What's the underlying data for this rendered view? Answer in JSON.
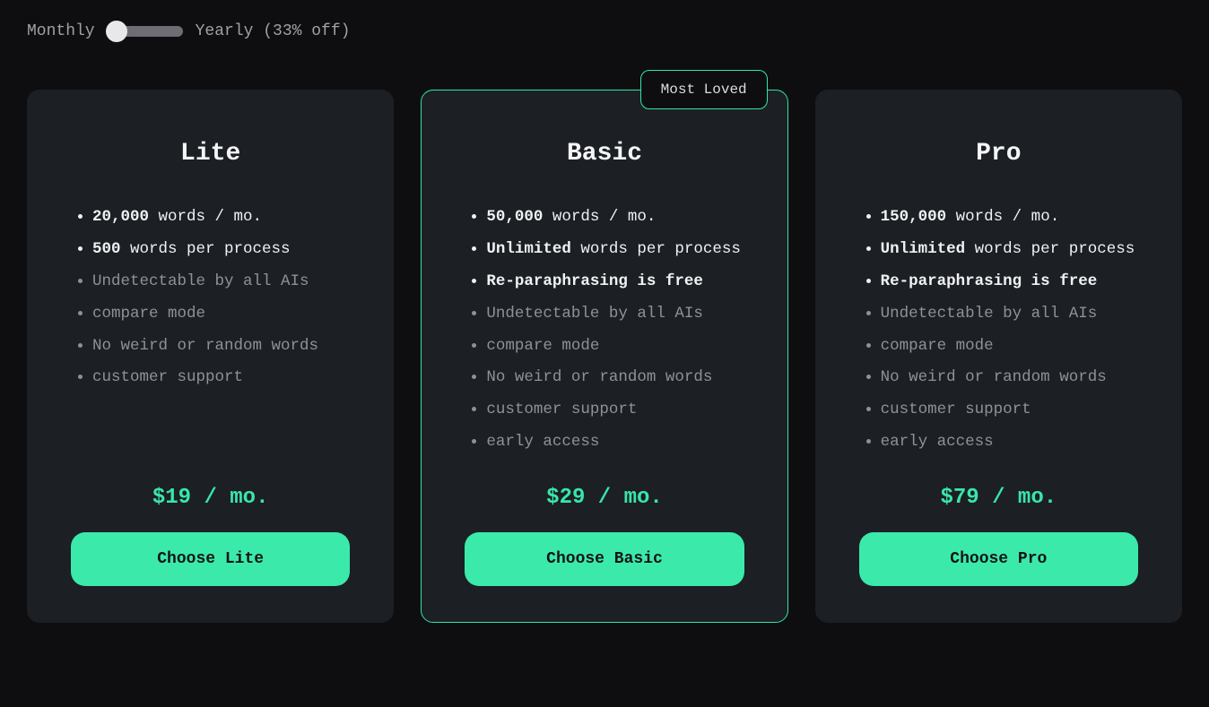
{
  "toggle": {
    "left": "Monthly",
    "right": "Yearly (33% off)"
  },
  "badge": "Most Loved",
  "plans": [
    {
      "title": "Lite",
      "price": "$19 / mo.",
      "button": "Choose Lite",
      "features": [
        {
          "bold": "20,000",
          "tail": " words / mo.",
          "style": "bold"
        },
        {
          "bold": "500",
          "tail": " words per process",
          "style": "bold"
        },
        {
          "text": "Undetectable by all AIs"
        },
        {
          "text": "compare mode"
        },
        {
          "text": "No weird or random words"
        },
        {
          "text": "customer support"
        }
      ]
    },
    {
      "title": "Basic",
      "price": "$29 / mo.",
      "button": "Choose Basic",
      "featured": true,
      "features": [
        {
          "bold": "50,000",
          "tail": " words / mo.",
          "style": "bold"
        },
        {
          "bold": "Unlimited",
          "tail": " words per process",
          "style": "bold"
        },
        {
          "bold": "Re-paraphrasing is free",
          "tail": "",
          "style": "bold"
        },
        {
          "text": "Undetectable by all AIs"
        },
        {
          "text": "compare mode"
        },
        {
          "text": "No weird or random words"
        },
        {
          "text": "customer support"
        },
        {
          "text": "early access"
        }
      ]
    },
    {
      "title": "Pro",
      "price": "$79 / mo.",
      "button": "Choose Pro",
      "features": [
        {
          "bold": "150,000",
          "tail": " words / mo.",
          "style": "bold"
        },
        {
          "bold": "Unlimited",
          "tail": " words per process",
          "style": "bold"
        },
        {
          "bold": "Re-paraphrasing is free",
          "tail": "",
          "style": "bold"
        },
        {
          "text": "Undetectable by all AIs"
        },
        {
          "text": "compare mode"
        },
        {
          "text": "No weird or random words"
        },
        {
          "text": "customer support"
        },
        {
          "text": "early access"
        }
      ]
    }
  ]
}
